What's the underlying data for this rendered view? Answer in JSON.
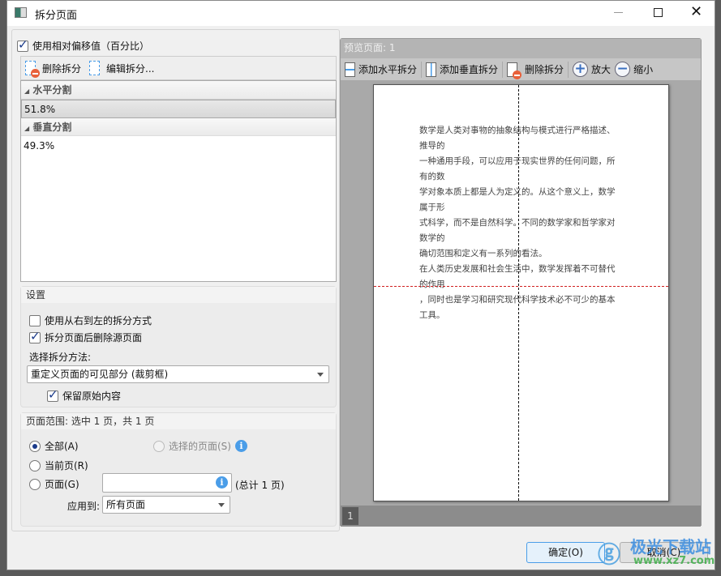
{
  "window": {
    "title": "拆分页面",
    "minimize_icon": "minimize-icon",
    "maximize_icon": "maximize-icon",
    "close_icon": "close-icon"
  },
  "left": {
    "use_relative": {
      "label": "使用相对偏移值（百分比）",
      "checked": true
    },
    "toolbar": {
      "delete_split": "删除拆分",
      "edit_split": "编辑拆分..."
    },
    "groups": [
      {
        "label": "水平分割",
        "items": [
          "51.8%"
        ]
      },
      {
        "label": "垂直分割",
        "items": [
          "49.3%"
        ]
      }
    ],
    "settings": {
      "title": "设置",
      "rtl": {
        "label": "使用从右到左的拆分方式",
        "checked": false
      },
      "delete_source": {
        "label": "拆分页面后删除源页面",
        "checked": true
      },
      "method_label": "选择拆分方法:",
      "method_value": "重定义页面的可见部分 (裁剪框)",
      "keep_original": {
        "label": "保留原始内容",
        "checked": true
      }
    },
    "range": {
      "title": "页面范围: 选中 1 页，共 1 页",
      "all": "全部(A)",
      "selected_pages": "选择的页面(S)",
      "current": "当前页(R)",
      "pages": "页面(G)",
      "pages_value": "",
      "total": "(总计 1 页)",
      "apply_label": "应用到:",
      "apply_value": "所有页面",
      "selected_option": "all"
    }
  },
  "preview": {
    "title": "预览页面: 1",
    "toolbar": {
      "add_horizontal": "添加水平拆分",
      "add_vertical": "添加垂直拆分",
      "delete_split": "删除拆分",
      "zoom_in": "放大",
      "zoom_out": "缩小"
    },
    "page_lines": [
      "数学是人类对事物的抽象结构与模式进行严格描述、",
      "推导的",
      "一种通用手段，可以应用于现实世界的任何问题，所",
      "有的数",
      "学对象本质上都是人为定义的。从这个意义上，数学",
      "属于形",
      "式科学，而不是自然科学。不同的数学家和哲学家对",
      "数学的",
      "确切范围和定义有一系列的看法。",
      "在人类历史发展和社会生活中，数学发挥着不可替代",
      "的作用",
      "，同时也是学习和研究现代科学技术必不可少的基本",
      "工具。"
    ],
    "page_number": "1",
    "split_color": "#d02020"
  },
  "buttons": {
    "ok": "确定(O)",
    "cancel": "取消(C)"
  },
  "watermark": {
    "text": "极光下载站",
    "url": "www.xz7.com"
  }
}
